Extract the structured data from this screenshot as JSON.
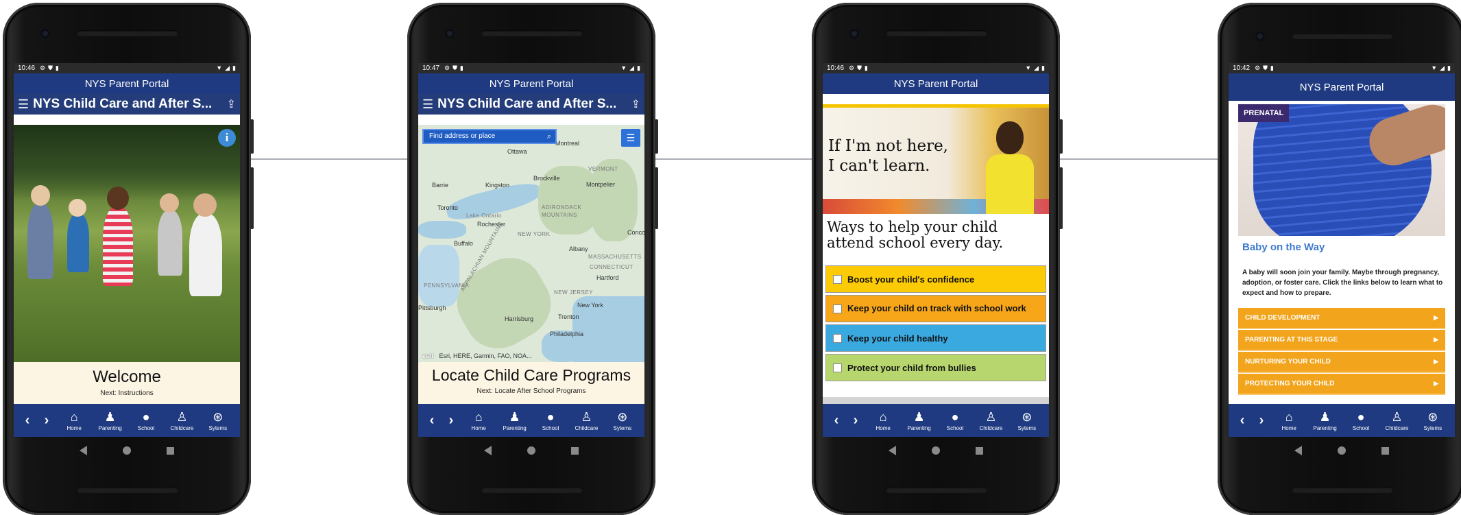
{
  "colors": {
    "app_bar": "#1f3a80",
    "accent_orange": "#f2a41c",
    "map_search": "#1f5cc2",
    "prenatal_badge": "#3b2a6e",
    "baby_title": "#3f7bd0"
  },
  "app_title": "NYS Parent Portal",
  "bottom_nav": {
    "back_icon": "chevron-left-icon",
    "forward_icon": "chevron-right-icon",
    "items": [
      {
        "label": "Home",
        "icon": "home-icon"
      },
      {
        "label": "Parenting",
        "icon": "parenting-icon"
      },
      {
        "label": "School",
        "icon": "apple-icon"
      },
      {
        "label": "Childcare",
        "icon": "childcare-icon"
      },
      {
        "label": "Sytems",
        "icon": "lifebuoy-icon"
      }
    ]
  },
  "screens": [
    {
      "time": "10:46",
      "subtitle": "NYS Child Care and After S...",
      "info_label": "i",
      "caption_title": "Welcome",
      "caption_next": "Next: Instructions"
    },
    {
      "time": "10:47",
      "subtitle": "NYS Child Care and After S...",
      "search_placeholder": "Find address or place",
      "map_labels": [
        "Montreal",
        "Ottawa",
        "Brockville",
        "Montpelier",
        "Kingston",
        "Barrie",
        "Toronto",
        "Lake Ontario",
        "Rochester",
        "Buffalo",
        "NEW YORK",
        "Albany",
        "MASSACHUSETTS",
        "Hartford",
        "CONNECTICUT",
        "PENNSYLVANIA",
        "Pittsburgh",
        "Harrisburg",
        "Trenton",
        "New York",
        "Philadelphia",
        "VERMONT",
        "ADIRONDACK MOUNTAINS",
        "APPALACHIAN MOUNTAINS",
        "NEW JERSEY",
        "Conco"
      ],
      "attribution_logo": "esri",
      "attribution": "Esri, HERE, Garmin, FAO, NOA...",
      "caption_title": "Locate Child Care Programs",
      "caption_next": "Next: Locate After School Programs"
    },
    {
      "time": "10:46",
      "banner_headline_line1": "If I'm not here,",
      "banner_headline_line2": "I can't learn.",
      "heading_line1": "Ways to help your child",
      "heading_line2": "attend school every day.",
      "checklist": [
        {
          "label": "Boost your child's confidence",
          "color": "#fccb05"
        },
        {
          "label": "Keep your child on track with school work",
          "color": "#f7a61a"
        },
        {
          "label": "Keep your child healthy",
          "color": "#3aa9e0"
        },
        {
          "label": "Protect your child from bullies",
          "color": "#b8d66e"
        }
      ]
    },
    {
      "time": "10:42",
      "badge": "PRENATAL",
      "title": "Baby on the Way",
      "body": "A baby will soon join your family. Maybe through pregnancy, adoption, or foster care. Click the links below to learn what to expect and how to prepare.",
      "accordion": [
        "CHILD DEVELOPMENT",
        "PARENTING AT THIS STAGE",
        "NURTURING YOUR CHILD",
        "PROTECTING YOUR CHILD"
      ]
    }
  ]
}
